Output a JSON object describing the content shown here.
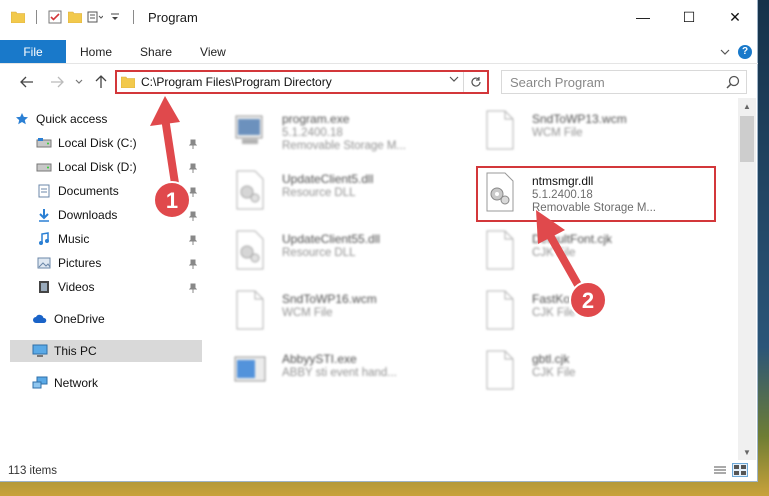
{
  "window": {
    "title": "Program",
    "controls": {
      "minimize": "—",
      "maximize": "☐",
      "close": "✕"
    }
  },
  "ribbon": {
    "file": "File",
    "tabs": [
      "Home",
      "Share",
      "View"
    ],
    "help": "?"
  },
  "address": {
    "path": "C:\\Program Files\\Program Directory",
    "search_placeholder": "Search Program"
  },
  "sidebar": {
    "quick_access": "Quick access",
    "items": [
      {
        "label": "Local Disk (C:)",
        "icon": "drive-icon",
        "pinned": true
      },
      {
        "label": "Local Disk (D:)",
        "icon": "drive-icon",
        "pinned": true
      },
      {
        "label": "Documents",
        "icon": "documents-icon",
        "pinned": true
      },
      {
        "label": "Downloads",
        "icon": "downloads-icon",
        "pinned": true
      },
      {
        "label": "Music",
        "icon": "music-icon",
        "pinned": true
      },
      {
        "label": "Pictures",
        "icon": "pictures-icon",
        "pinned": true
      },
      {
        "label": "Videos",
        "icon": "videos-icon",
        "pinned": true
      }
    ],
    "onedrive": "OneDrive",
    "this_pc": "This PC",
    "network": "Network"
  },
  "files": [
    {
      "name": "program.exe",
      "line2": "5.1.2400.18",
      "line3": "Removable Storage M...",
      "icon": "exe-icon"
    },
    {
      "name": "SndToWP13.wcm",
      "line2": "WCM File",
      "line3": "",
      "icon": "file-icon"
    },
    {
      "name": "UpdateClient5.dll",
      "line2": "Resource DLL",
      "line3": "",
      "icon": "dll-icon"
    },
    {
      "name": "ntmsmgr.dll",
      "line2": "5.1.2400.18",
      "line3": "Removable Storage M...",
      "icon": "dll-icon"
    },
    {
      "name": "UpdateClient55.dll",
      "line2": "Resource DLL",
      "line3": "",
      "icon": "dll-icon"
    },
    {
      "name": "DefaultFont.cjk",
      "line2": "CJK File",
      "line3": "",
      "icon": "file-icon"
    },
    {
      "name": "SndToWP16.wcm",
      "line2": "WCM File",
      "line3": "",
      "icon": "file-icon"
    },
    {
      "name": "FastKor.cjk",
      "line2": "CJK File",
      "line3": "",
      "icon": "file-icon"
    },
    {
      "name": "AbbyySTI.exe",
      "line2": "ABBY sti event hand...",
      "line3": "",
      "icon": "app-icon"
    },
    {
      "name": "gbtl.cjk",
      "line2": "CJK File",
      "line3": "",
      "icon": "file-icon"
    }
  ],
  "status": {
    "count": "113 items"
  },
  "annotations": {
    "step1": "1",
    "step2": "2"
  },
  "colors": {
    "accent": "#1979ca",
    "highlight": "#d3373a",
    "arrow": "#e0494c"
  }
}
